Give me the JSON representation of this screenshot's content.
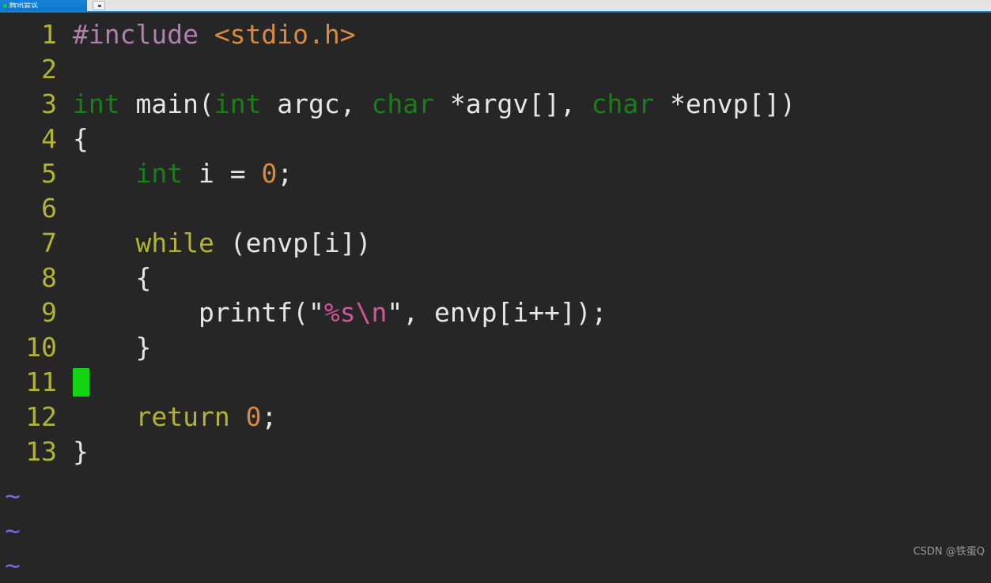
{
  "window_chrome": {
    "taskbar_app_label": "腾讯会议",
    "taskbar_status_icon": "green-dot-icon",
    "tab_icon": "window-tab-icon",
    "colors": {
      "strip_background": "#e4e4e2",
      "taskbar_blue": "#1683d8",
      "band_blue": "#2f8fe0"
    }
  },
  "editor": {
    "type": "vim-terminal-editor",
    "background": "#262626",
    "gutter_color": "#b3b334",
    "cursor": {
      "line": 11,
      "column": 1,
      "color": "#13d413",
      "shape": "block"
    },
    "lines": [
      {
        "number": "1",
        "tokens": [
          {
            "t": "#include ",
            "c": "tok-pre"
          },
          {
            "t": "<stdio.h>",
            "c": "tok-header"
          }
        ]
      },
      {
        "number": "2",
        "tokens": []
      },
      {
        "number": "3",
        "tokens": [
          {
            "t": "int",
            "c": "tok-type"
          },
          {
            "t": " main(",
            "c": "tok-plain"
          },
          {
            "t": "int",
            "c": "tok-type"
          },
          {
            "t": " argc, ",
            "c": "tok-plain"
          },
          {
            "t": "char",
            "c": "tok-type"
          },
          {
            "t": " *argv[], ",
            "c": "tok-plain"
          },
          {
            "t": "char",
            "c": "tok-type"
          },
          {
            "t": " *envp[])",
            "c": "tok-plain"
          }
        ]
      },
      {
        "number": "4",
        "tokens": [
          {
            "t": "{",
            "c": "tok-plain"
          }
        ]
      },
      {
        "number": "5",
        "tokens": [
          {
            "t": "    ",
            "c": "tok-plain"
          },
          {
            "t": "int",
            "c": "tok-type"
          },
          {
            "t": " i = ",
            "c": "tok-plain"
          },
          {
            "t": "0",
            "c": "tok-num"
          },
          {
            "t": ";",
            "c": "tok-plain"
          }
        ]
      },
      {
        "number": "6",
        "tokens": []
      },
      {
        "number": "7",
        "tokens": [
          {
            "t": "    ",
            "c": "tok-plain"
          },
          {
            "t": "while",
            "c": "tok-keyword"
          },
          {
            "t": " (envp[i])",
            "c": "tok-plain"
          }
        ]
      },
      {
        "number": "8",
        "tokens": [
          {
            "t": "    {",
            "c": "tok-plain"
          }
        ]
      },
      {
        "number": "9",
        "tokens": [
          {
            "t": "        printf(",
            "c": "tok-plain"
          },
          {
            "t": "\"",
            "c": "tok-quote"
          },
          {
            "t": "%s\\n",
            "c": "tok-string"
          },
          {
            "t": "\"",
            "c": "tok-quote"
          },
          {
            "t": ", envp[i++]);",
            "c": "tok-plain"
          }
        ]
      },
      {
        "number": "10",
        "tokens": [
          {
            "t": "    }",
            "c": "tok-plain"
          }
        ]
      },
      {
        "number": "11",
        "tokens": [],
        "cursor": true
      },
      {
        "number": "12",
        "tokens": [
          {
            "t": "    ",
            "c": "tok-plain"
          },
          {
            "t": "return",
            "c": "tok-keyword"
          },
          {
            "t": " ",
            "c": "tok-plain"
          },
          {
            "t": "0",
            "c": "tok-num"
          },
          {
            "t": ";",
            "c": "tok-plain"
          }
        ]
      },
      {
        "number": "13",
        "tokens": [
          {
            "t": "}",
            "c": "tok-plain"
          }
        ]
      }
    ],
    "empty_line_markers": {
      "glyph": "~",
      "color": "#6c6ce0",
      "count": 3
    }
  },
  "watermark": {
    "text": "CSDN @铁蛋Q"
  }
}
